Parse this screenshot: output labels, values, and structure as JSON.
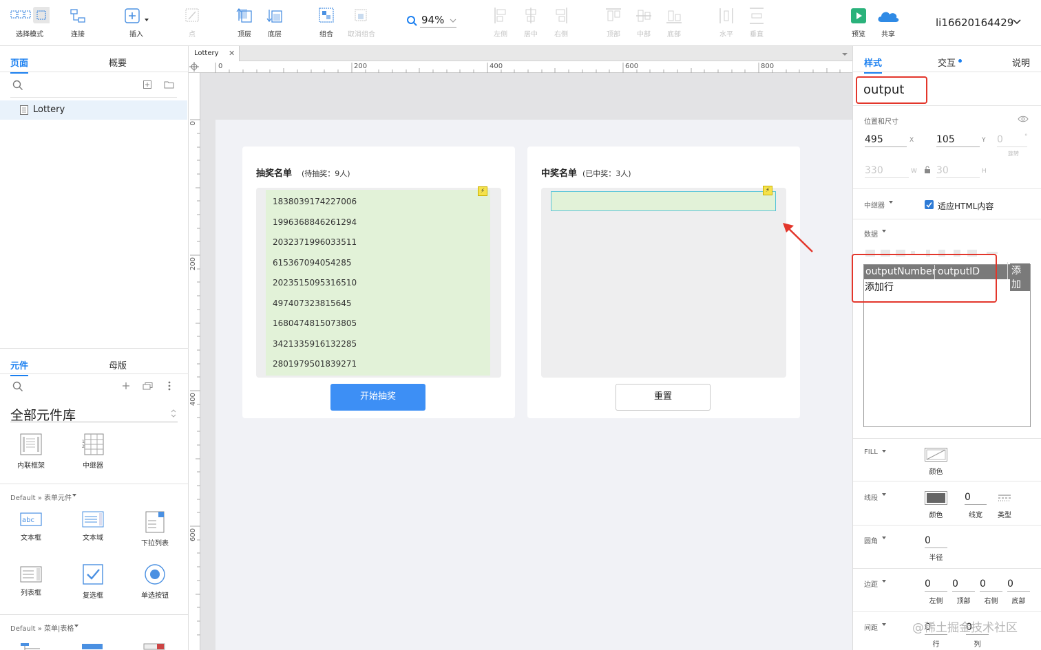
{
  "toolbar": {
    "select_mode": "选择模式",
    "connect": "连接",
    "insert": "插入",
    "point": "点",
    "top_layer": "顶层",
    "bottom_layer": "底层",
    "group": "组合",
    "ungroup": "取消组合",
    "zoom": "94%",
    "align_left": "左侧",
    "align_center": "居中",
    "align_right": "右侧",
    "align_top": "顶部",
    "align_middle": "中部",
    "align_bottom": "底部",
    "dist_horizontal": "水平",
    "dist_vertical": "垂直",
    "preview": "预览",
    "share": "共享",
    "user": "li16620164429",
    "accent": "#1a7ff0",
    "preview_color": "#2ab27b"
  },
  "left": {
    "tab_pages": "页面",
    "tab_outline": "概要",
    "page_item": "Lottery",
    "tab_widgets": "元件",
    "tab_masters": "母版",
    "library_title": "全部元件库",
    "widgets_top": [
      "内联框架",
      "中继器"
    ],
    "section_form": "Default » 表单元件",
    "form_row1": [
      "文本框",
      "文本域",
      "下拉列表"
    ],
    "form_row2": [
      "列表框",
      "复选框",
      "单选按钮"
    ],
    "section_menu": "Default » 菜单|表格"
  },
  "canvas": {
    "doc_tab": "Lottery",
    "ruler_h": [
      "0",
      "200",
      "400",
      "600",
      "800"
    ],
    "ruler_v": [
      "0",
      "200",
      "400",
      "600"
    ],
    "card1": {
      "title": "抽奖名单",
      "subtitle": "(待抽奖：9人)",
      "numbers": [
        "1838039174227006",
        "1996368846261294",
        "2032371996033511",
        "615367094054285",
        "2023515095316510",
        "497407323815645",
        "1680474815073805",
        "3421335916132285",
        "2801979501839271"
      ],
      "button": "开始抽奖"
    },
    "card2": {
      "title": "中奖名单",
      "subtitle": "(已中奖：3人)",
      "button": "重置"
    },
    "list_bg": "#e2f2d8",
    "button_color": "#3d8ff5"
  },
  "right": {
    "tab_style": "样式",
    "tab_interact": "交互",
    "tab_notes": "说明",
    "widget_name": "output",
    "section_pos": "位置和尺寸",
    "x_val": "495",
    "x_label": "X",
    "y_val": "105",
    "y_label": "Y",
    "rot_val": "0",
    "rot_unit": "°",
    "rot_label": "旋转",
    "w_val": "330",
    "w_label": "W",
    "h_val": "30",
    "h_label": "H",
    "section_repeater": "中继器",
    "fit_html": "适应HTML内容",
    "section_data": "数据",
    "columns": [
      "outputNumber",
      "outputID"
    ],
    "add_col": "添加",
    "add_row": "添加行",
    "section_fill": "FILL",
    "fill_color_label": "颜色",
    "section_border": "线段",
    "border_color_label": "颜色",
    "border_width": "0",
    "border_width_label": "线宽",
    "border_type_label": "类型",
    "section_radius": "圆角",
    "radius_val": "0",
    "radius_label": "半径",
    "section_padding": "边距",
    "padding_vals": [
      "0",
      "0",
      "0",
      "0"
    ],
    "padding_labels": [
      "左侧",
      "顶部",
      "右侧",
      "底部"
    ],
    "section_spacing": "间距",
    "spacing_vals": [
      "0",
      "0"
    ],
    "spacing_labels": [
      "行",
      "列"
    ],
    "highlight_color": "#e3362b"
  },
  "watermark": "@稀土掘金技术社区"
}
